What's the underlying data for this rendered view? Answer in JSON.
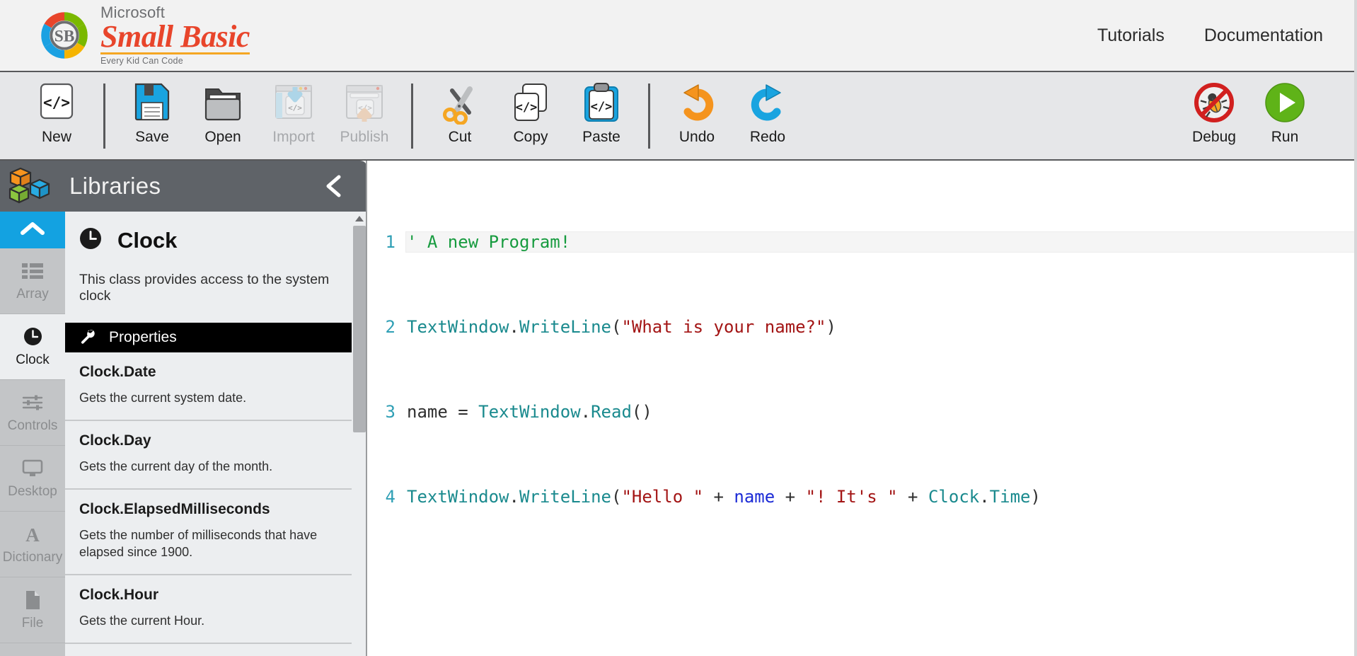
{
  "header": {
    "logo": {
      "microsoft": "Microsoft",
      "product": "Small Basic",
      "tagline": "Every Kid Can Code"
    },
    "nav": [
      {
        "label": "Tutorials",
        "name": "nav-tutorials"
      },
      {
        "label": "Documentation",
        "name": "nav-documentation"
      }
    ]
  },
  "toolbar": {
    "left": [
      {
        "label": "New",
        "icon": "code-file-icon",
        "disabled": false
      },
      {
        "label": "Save",
        "icon": "floppy-disk-icon",
        "disabled": false
      },
      {
        "label": "Open",
        "icon": "folder-icon",
        "disabled": false
      },
      {
        "label": "Import",
        "icon": "import-icon",
        "disabled": true
      },
      {
        "label": "Publish",
        "icon": "publish-icon",
        "disabled": true
      },
      {
        "label": "Cut",
        "icon": "scissors-icon",
        "disabled": false
      },
      {
        "label": "Copy",
        "icon": "copy-icon",
        "disabled": false
      },
      {
        "label": "Paste",
        "icon": "clipboard-icon",
        "disabled": false
      },
      {
        "label": "Undo",
        "icon": "undo-arrow-icon",
        "disabled": false
      },
      {
        "label": "Redo",
        "icon": "redo-arrow-icon",
        "disabled": false
      }
    ],
    "right": [
      {
        "label": "Debug",
        "icon": "bug-disabled-icon",
        "disabled": false
      },
      {
        "label": "Run",
        "icon": "play-icon",
        "disabled": false
      }
    ]
  },
  "libraries": {
    "title": "Libraries",
    "collapse_icon": "chevron-left-icon",
    "cube_icon": "cubes-icon",
    "rail_top_icon": "chevron-up-icon",
    "rail": [
      {
        "label": "Array",
        "icon": "grid-list-icon",
        "active": false
      },
      {
        "label": "Clock",
        "icon": "clock-icon",
        "active": true
      },
      {
        "label": "Controls",
        "icon": "sliders-icon",
        "active": false
      },
      {
        "label": "Desktop",
        "icon": "monitor-icon",
        "active": false
      },
      {
        "label": "Dictionary",
        "icon": "letter-a-icon",
        "active": false
      },
      {
        "label": "File",
        "icon": "document-icon",
        "active": false
      }
    ],
    "selected_class": {
      "name": "Clock",
      "icon": "clock-icon",
      "description": "This class provides access to the system clock",
      "section_label": "Properties",
      "section_icon": "wrench-icon",
      "members": [
        {
          "name": "Clock.Date",
          "description": "Gets the current system date."
        },
        {
          "name": "Clock.Day",
          "description": "Gets the current day of the month."
        },
        {
          "name": "Clock.ElapsedMilliseconds",
          "description": "Gets the number of milliseconds that have elapsed since 1900."
        },
        {
          "name": "Clock.Hour",
          "description": "Gets the current Hour."
        }
      ]
    }
  },
  "editor": {
    "lines": [
      {
        "number": "1",
        "current": true,
        "tokens": [
          {
            "t": "' A new Program!",
            "c": "tok-com"
          }
        ]
      },
      {
        "number": "2",
        "current": false,
        "tokens": [
          {
            "t": "TextWindow",
            "c": "tok-cls"
          },
          {
            "t": ".",
            "c": "tok-pun"
          },
          {
            "t": "WriteLine",
            "c": "tok-mem"
          },
          {
            "t": "(",
            "c": "tok-pun"
          },
          {
            "t": "\"What is your name?\"",
            "c": "tok-str"
          },
          {
            "t": ")",
            "c": "tok-pun"
          }
        ]
      },
      {
        "number": "3",
        "current": false,
        "tokens": [
          {
            "t": "name",
            "c": "tok-pun"
          },
          {
            "t": " = ",
            "c": "tok-op"
          },
          {
            "t": "TextWindow",
            "c": "tok-cls"
          },
          {
            "t": ".",
            "c": "tok-pun"
          },
          {
            "t": "Read",
            "c": "tok-mem"
          },
          {
            "t": "()",
            "c": "tok-pun"
          }
        ]
      },
      {
        "number": "4",
        "current": false,
        "tokens": [
          {
            "t": "TextWindow",
            "c": "tok-cls"
          },
          {
            "t": ".",
            "c": "tok-pun"
          },
          {
            "t": "WriteLine",
            "c": "tok-mem"
          },
          {
            "t": "(",
            "c": "tok-pun"
          },
          {
            "t": "\"Hello \"",
            "c": "tok-str"
          },
          {
            "t": " + ",
            "c": "tok-op"
          },
          {
            "t": "name",
            "c": "tok-var"
          },
          {
            "t": " + ",
            "c": "tok-op"
          },
          {
            "t": "\"! It's \"",
            "c": "tok-str"
          },
          {
            "t": " + ",
            "c": "tok-op"
          },
          {
            "t": "Clock",
            "c": "tok-cls"
          },
          {
            "t": ".",
            "c": "tok-pun"
          },
          {
            "t": "Time",
            "c": "tok-mem"
          },
          {
            "t": ")",
            "c": "tok-pun"
          }
        ]
      }
    ]
  },
  "colors": {
    "accent_blue": "#13a2e1",
    "brand_red": "#e8452b",
    "brand_orange": "#f5a623",
    "run_green": "#5fb318",
    "debug_red": "#d1201f",
    "header_bg": "#f2f2f2",
    "toolbar_bg": "#e6e7e9",
    "panel_bg": "#eceef0",
    "rail_bg": "#c3c5c7",
    "lib_header_bg": "#5f6368"
  }
}
